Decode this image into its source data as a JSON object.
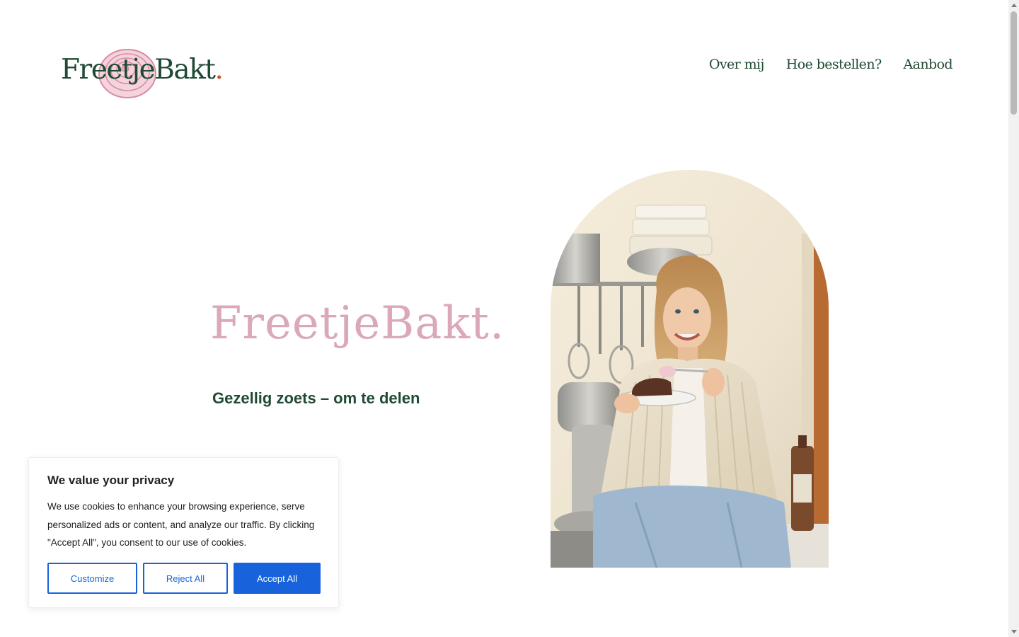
{
  "header": {
    "logo_text": "FreetjeBakt",
    "logo_dot": "."
  },
  "nav": {
    "items": [
      {
        "label": "Over mij"
      },
      {
        "label": "Hoe bestellen?"
      },
      {
        "label": "Aanbod"
      }
    ]
  },
  "hero": {
    "title": "FreetjeBakt.",
    "subtitle": "Gezellig zoets – om te delen"
  },
  "cookie_banner": {
    "title": "We value your privacy",
    "text": "We use cookies to enhance your browsing experience, serve personalized ads or content, and analyze our traffic. By clicking \"Accept All\", you consent to our use of cookies.",
    "customize_label": "Customize",
    "reject_label": "Reject All",
    "accept_label": "Accept All"
  },
  "colors": {
    "brand_green": "#1f4a33",
    "brand_pink": "#dba8b8",
    "logo_dot": "#c2522c",
    "button_blue": "#1863dc"
  }
}
